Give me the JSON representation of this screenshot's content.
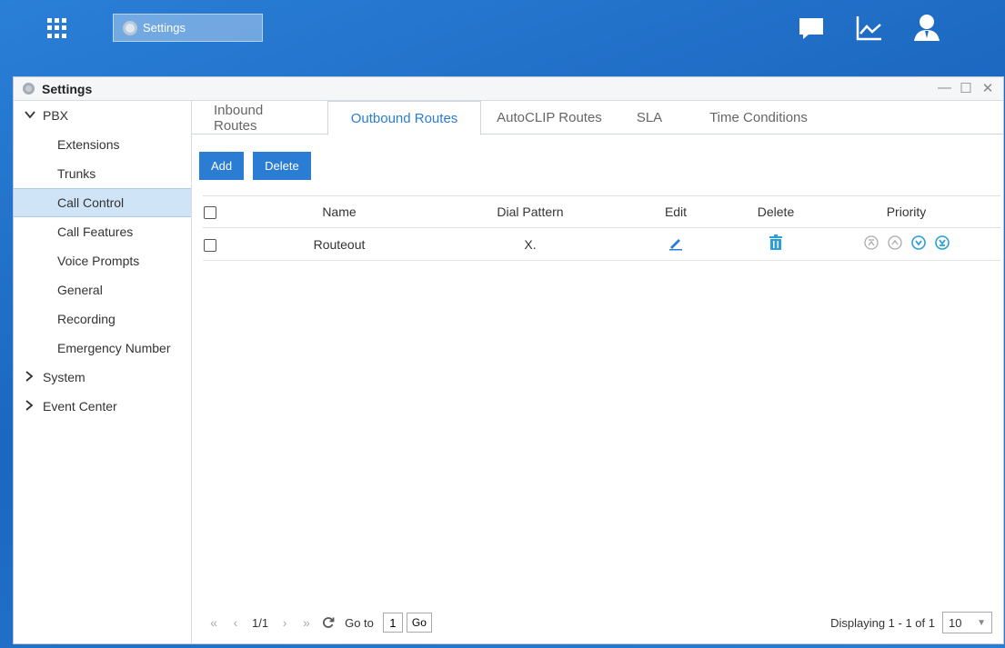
{
  "taskbar": {
    "tab_label": "Settings",
    "icons": [
      "chat-icon",
      "chart-icon",
      "user-icon"
    ]
  },
  "window": {
    "title": "Settings",
    "controls": [
      "—",
      "☐",
      "✕"
    ]
  },
  "sidebar": {
    "groups": [
      {
        "label": "PBX",
        "expanded": true
      },
      {
        "label": "System",
        "expanded": false
      },
      {
        "label": "Event Center",
        "expanded": false
      }
    ],
    "items": [
      {
        "label": "Extensions"
      },
      {
        "label": "Trunks"
      },
      {
        "label": "Call Control"
      },
      {
        "label": "Call Features"
      },
      {
        "label": "Voice Prompts"
      },
      {
        "label": "General"
      },
      {
        "label": "Recording"
      },
      {
        "label": "Emergency Number"
      }
    ],
    "active_item": "Call Control"
  },
  "tabs": [
    {
      "label": "Inbound Routes"
    },
    {
      "label": "Outbound Routes"
    },
    {
      "label": "AutoCLIP Routes"
    },
    {
      "label": "SLA"
    },
    {
      "label": "Time Conditions"
    }
  ],
  "active_tab": "Outbound Routes",
  "toolbar": {
    "add_label": "Add",
    "delete_label": "Delete"
  },
  "table": {
    "headers": {
      "name": "Name",
      "pattern": "Dial Pattern",
      "edit": "Edit",
      "delete": "Delete",
      "priority": "Priority"
    },
    "rows": [
      {
        "name": "Routeout",
        "pattern": "X."
      }
    ]
  },
  "pager": {
    "page": "1/1",
    "goto_label": "Go to",
    "goto_value": "1",
    "go_button": "Go",
    "displaying": "Displaying 1 - 1 of 1",
    "page_size": "10"
  },
  "colors": {
    "accent": "#2a7dd3",
    "active_sidebar": "#cfe5f7",
    "priority_enabled": "#2a9fd8",
    "priority_disabled": "#aaaaaa"
  }
}
